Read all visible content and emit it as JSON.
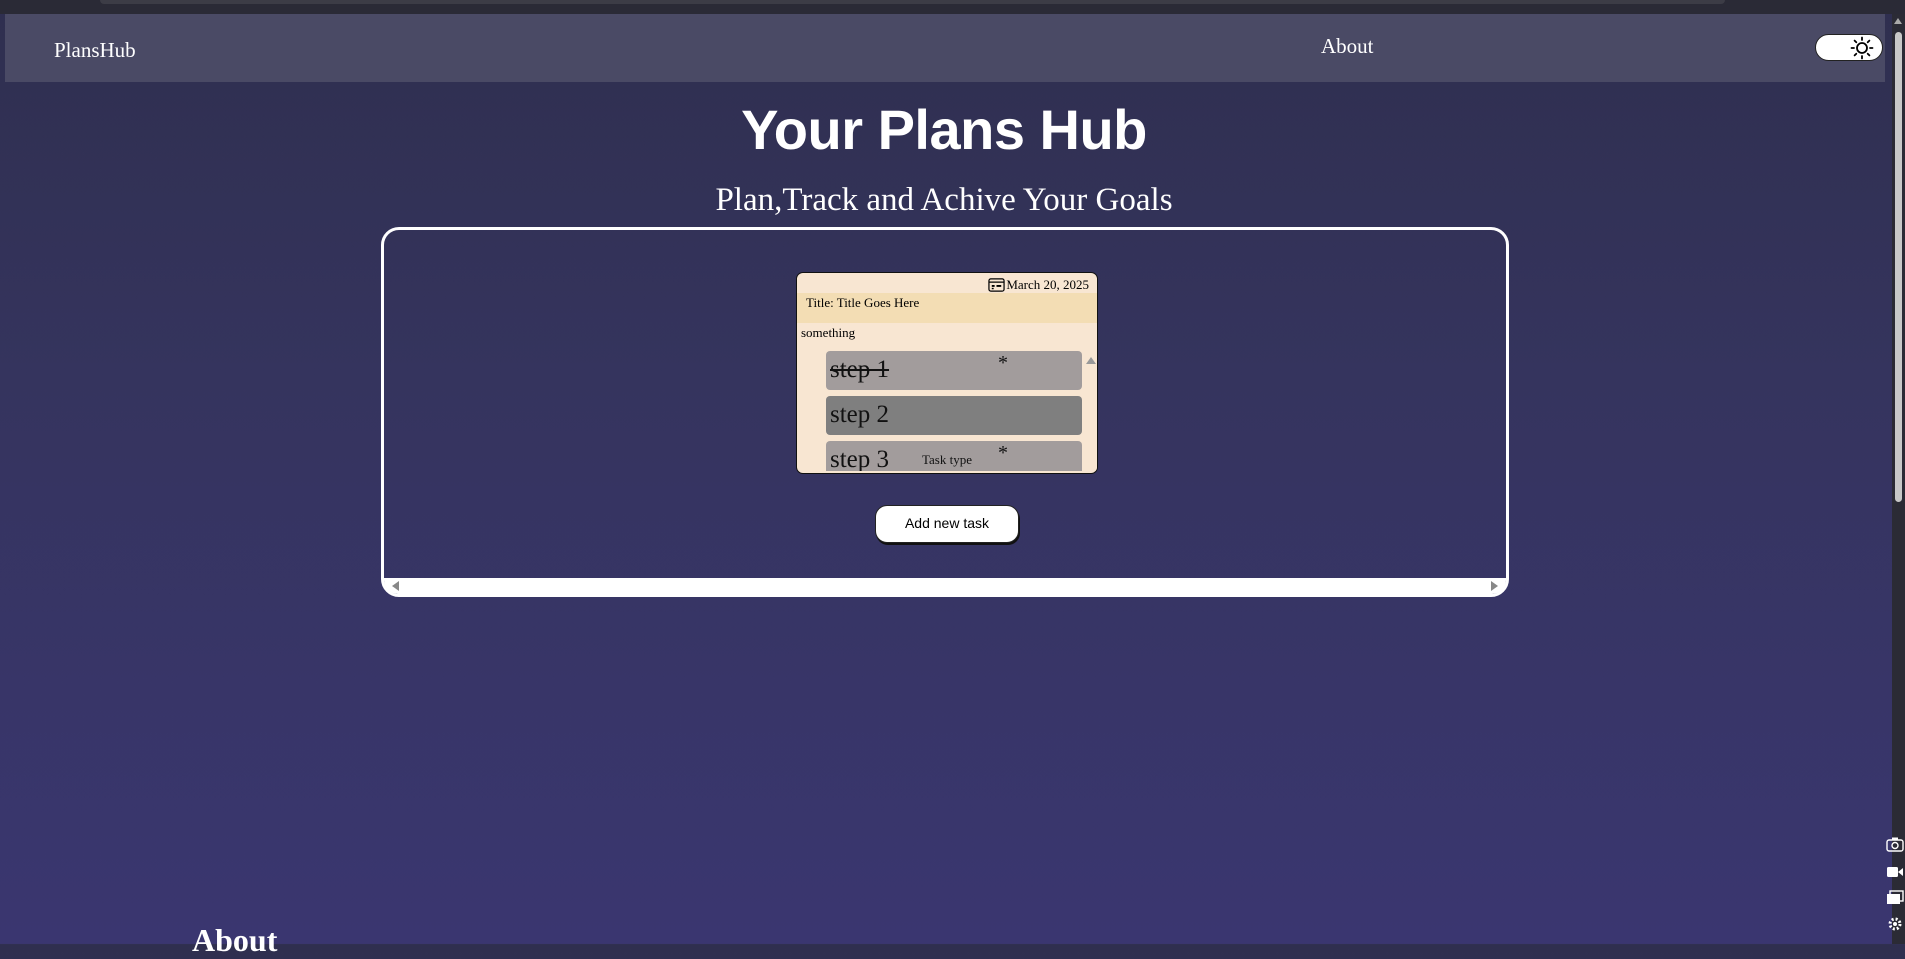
{
  "navbar": {
    "brand": "PlansHub",
    "about_link": "About",
    "theme_toggle_icon": "sun-icon"
  },
  "hero": {
    "title": "Your Plans Hub",
    "subtitle": "Plan,Track and Achive Your Goals"
  },
  "task_card": {
    "date": "March 20, 2025",
    "date_icon": "calendar-icon",
    "title": "Title: Title Goes Here",
    "description": "something",
    "steps": [
      {
        "label": "step 1",
        "completed": true,
        "marker": "*"
      },
      {
        "label": "step 2",
        "completed": false
      },
      {
        "label": "step 3",
        "completed": false,
        "task_type": "Task type",
        "marker": "*"
      }
    ]
  },
  "actions": {
    "add_task_label": "Add new task"
  },
  "about_section": {
    "heading": "About"
  },
  "colors": {
    "background_top": "#2f2f4f",
    "background_bottom": "#3a3670",
    "navbar": "#4a4a65",
    "card_bg": "#f8e6d2",
    "card_title_bar": "#f3ddb4",
    "step_bg": "#a29c9c",
    "step_active_bg": "#7f7f7f"
  }
}
